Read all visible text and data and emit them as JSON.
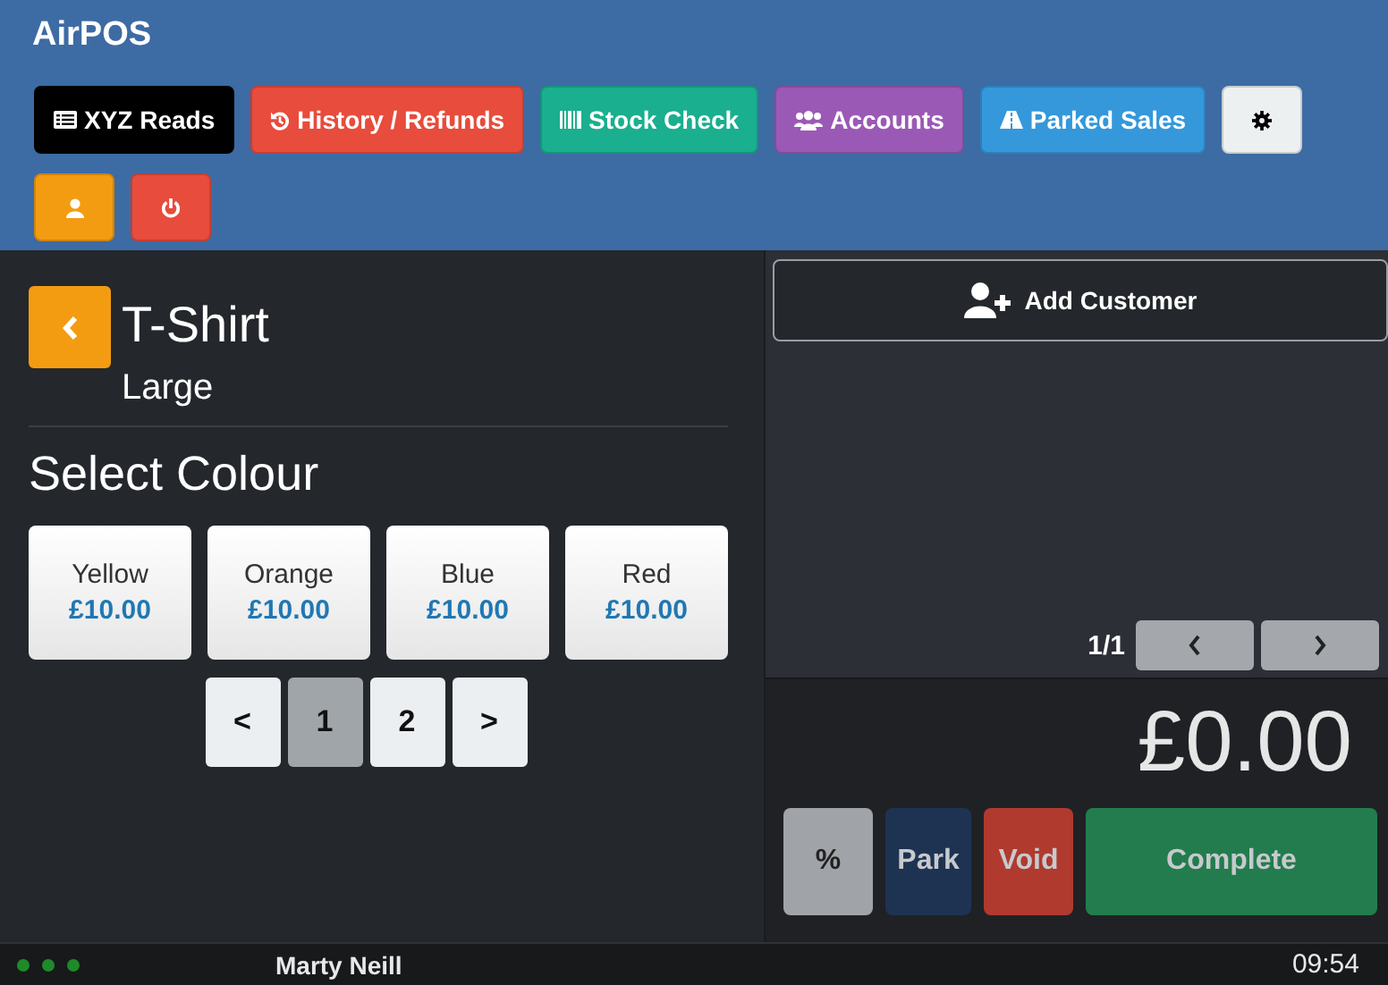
{
  "app": {
    "title": "AirPOS"
  },
  "toolbar": [
    {
      "kind": "reads",
      "label": "XYZ Reads",
      "color": "#000000"
    },
    {
      "kind": "history",
      "label": "History / Refunds",
      "color": "#e74c3c"
    },
    {
      "kind": "stock",
      "label": "Stock Check",
      "color": "#1aaf8e"
    },
    {
      "kind": "accounts",
      "label": "Accounts",
      "color": "#9b59b6"
    },
    {
      "kind": "parked",
      "label": "Parked Sales",
      "color": "#3498db"
    },
    {
      "kind": "settings",
      "color": "#ecf0f1"
    },
    {
      "kind": "user",
      "color": "#f39c12"
    },
    {
      "kind": "power",
      "color": "#e74c3c"
    }
  ],
  "product": {
    "title": "T-Shirt",
    "subtitle": "Large",
    "heading": "Select Colour",
    "options": [
      {
        "name": "Yellow",
        "price": "£10.00"
      },
      {
        "name": "Orange",
        "price": "£10.00"
      },
      {
        "name": "Blue",
        "price": "£10.00"
      },
      {
        "name": "Red",
        "price": "£10.00"
      }
    ],
    "pages": [
      {
        "label": "<",
        "selected": false
      },
      {
        "label": "1",
        "selected": true
      },
      {
        "label": "2",
        "selected": false
      },
      {
        "label": ">",
        "selected": false
      }
    ]
  },
  "cart": {
    "add_customer": "Add Customer",
    "page": "1/1",
    "total": "£0.00",
    "actions": [
      {
        "label": "%",
        "color": "#a0a4a8"
      },
      {
        "label": "Park",
        "color": "#1e3352"
      },
      {
        "label": "Void",
        "color": "#b03a2e"
      },
      {
        "label": "Complete",
        "color": "#237c4d"
      }
    ]
  },
  "status_bar": {
    "user": "Marty Neill",
    "time": "09:54"
  }
}
